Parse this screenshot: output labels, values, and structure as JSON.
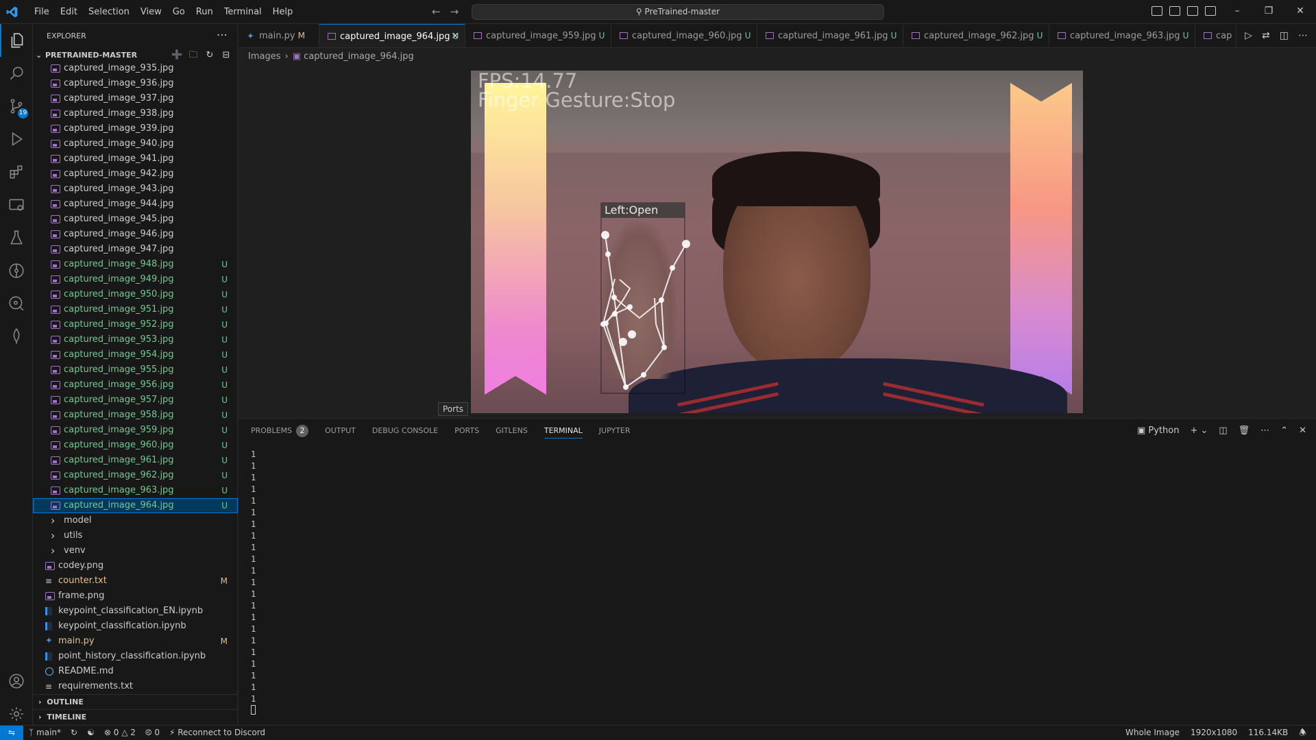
{
  "titlebar": {
    "menu": [
      "File",
      "Edit",
      "Selection",
      "View",
      "Go",
      "Run",
      "Terminal",
      "Help"
    ],
    "search_text": "PreTrained-master"
  },
  "activity": {
    "scm_badge": "19"
  },
  "sidebar": {
    "title": "EXPLORER",
    "project": "PRETRAINED-MASTER",
    "items": [
      {
        "name": "captured_image_935.jpg",
        "kind": "img",
        "status": "",
        "color": "#cccccc",
        "indent": 1
      },
      {
        "name": "captured_image_936.jpg",
        "kind": "img",
        "status": "",
        "color": "#cccccc",
        "indent": 1
      },
      {
        "name": "captured_image_937.jpg",
        "kind": "img",
        "status": "",
        "color": "#cccccc",
        "indent": 1
      },
      {
        "name": "captured_image_938.jpg",
        "kind": "img",
        "status": "",
        "color": "#cccccc",
        "indent": 1
      },
      {
        "name": "captured_image_939.jpg",
        "kind": "img",
        "status": "",
        "color": "#cccccc",
        "indent": 1
      },
      {
        "name": "captured_image_940.jpg",
        "kind": "img",
        "status": "",
        "color": "#cccccc",
        "indent": 1
      },
      {
        "name": "captured_image_941.jpg",
        "kind": "img",
        "status": "",
        "color": "#cccccc",
        "indent": 1
      },
      {
        "name": "captured_image_942.jpg",
        "kind": "img",
        "status": "",
        "color": "#cccccc",
        "indent": 1
      },
      {
        "name": "captured_image_943.jpg",
        "kind": "img",
        "status": "",
        "color": "#cccccc",
        "indent": 1
      },
      {
        "name": "captured_image_944.jpg",
        "kind": "img",
        "status": "",
        "color": "#cccccc",
        "indent": 1
      },
      {
        "name": "captured_image_945.jpg",
        "kind": "img",
        "status": "",
        "color": "#cccccc",
        "indent": 1
      },
      {
        "name": "captured_image_946.jpg",
        "kind": "img",
        "status": "",
        "color": "#cccccc",
        "indent": 1
      },
      {
        "name": "captured_image_947.jpg",
        "kind": "img",
        "status": "",
        "color": "#cccccc",
        "indent": 1
      },
      {
        "name": "captured_image_948.jpg",
        "kind": "img",
        "status": "U",
        "color": "#73c991",
        "indent": 1
      },
      {
        "name": "captured_image_949.jpg",
        "kind": "img",
        "status": "U",
        "color": "#73c991",
        "indent": 1
      },
      {
        "name": "captured_image_950.jpg",
        "kind": "img",
        "status": "U",
        "color": "#73c991",
        "indent": 1
      },
      {
        "name": "captured_image_951.jpg",
        "kind": "img",
        "status": "U",
        "color": "#73c991",
        "indent": 1
      },
      {
        "name": "captured_image_952.jpg",
        "kind": "img",
        "status": "U",
        "color": "#73c991",
        "indent": 1
      },
      {
        "name": "captured_image_953.jpg",
        "kind": "img",
        "status": "U",
        "color": "#73c991",
        "indent": 1
      },
      {
        "name": "captured_image_954.jpg",
        "kind": "img",
        "status": "U",
        "color": "#73c991",
        "indent": 1
      },
      {
        "name": "captured_image_955.jpg",
        "kind": "img",
        "status": "U",
        "color": "#73c991",
        "indent": 1
      },
      {
        "name": "captured_image_956.jpg",
        "kind": "img",
        "status": "U",
        "color": "#73c991",
        "indent": 1
      },
      {
        "name": "captured_image_957.jpg",
        "kind": "img",
        "status": "U",
        "color": "#73c991",
        "indent": 1
      },
      {
        "name": "captured_image_958.jpg",
        "kind": "img",
        "status": "U",
        "color": "#73c991",
        "indent": 1
      },
      {
        "name": "captured_image_959.jpg",
        "kind": "img",
        "status": "U",
        "color": "#73c991",
        "indent": 1
      },
      {
        "name": "captured_image_960.jpg",
        "kind": "img",
        "status": "U",
        "color": "#73c991",
        "indent": 1
      },
      {
        "name": "captured_image_961.jpg",
        "kind": "img",
        "status": "U",
        "color": "#73c991",
        "indent": 1
      },
      {
        "name": "captured_image_962.jpg",
        "kind": "img",
        "status": "U",
        "color": "#73c991",
        "indent": 1
      },
      {
        "name": "captured_image_963.jpg",
        "kind": "img",
        "status": "U",
        "color": "#73c991",
        "indent": 1
      },
      {
        "name": "captured_image_964.jpg",
        "kind": "img",
        "status": "U",
        "color": "#73c991",
        "indent": 1,
        "selected": true
      },
      {
        "name": "model",
        "kind": "folder",
        "status": "",
        "color": "#cccccc",
        "indent": 1
      },
      {
        "name": "utils",
        "kind": "folder",
        "status": "",
        "color": "#cccccc",
        "indent": 1
      },
      {
        "name": "venv",
        "kind": "folder",
        "status": "",
        "color": "#cccccc",
        "indent": 1
      },
      {
        "name": "codey.png",
        "kind": "img",
        "status": "",
        "color": "#cccccc",
        "indent": 0
      },
      {
        "name": "counter.txt",
        "kind": "txt",
        "status": "M",
        "color": "#e2c08d",
        "indent": 0
      },
      {
        "name": "frame.png",
        "kind": "img",
        "status": "",
        "color": "#cccccc",
        "indent": 0
      },
      {
        "name": "keypoint_classification_EN.ipynb",
        "kind": "nb",
        "status": "",
        "color": "#cccccc",
        "indent": 0
      },
      {
        "name": "keypoint_classification.ipynb",
        "kind": "nb",
        "status": "",
        "color": "#cccccc",
        "indent": 0
      },
      {
        "name": "main.py",
        "kind": "py",
        "status": "M",
        "color": "#e2c08d",
        "indent": 0
      },
      {
        "name": "point_history_classification.ipynb",
        "kind": "nb",
        "status": "",
        "color": "#cccccc",
        "indent": 0
      },
      {
        "name": "README.md",
        "kind": "info",
        "status": "",
        "color": "#cccccc",
        "indent": 0
      },
      {
        "name": "requirements.txt",
        "kind": "txt",
        "status": "",
        "color": "#cccccc",
        "indent": 0
      }
    ],
    "outline_label": "OUTLINE",
    "timeline_label": "TIMELINE"
  },
  "tabs": [
    {
      "label": "main.py",
      "status": "M",
      "status_color": "#e2c08d",
      "kind": "py"
    },
    {
      "label": "captured_image_964.jpg",
      "status": "U",
      "status_color": "#73c991",
      "kind": "img",
      "active": true
    },
    {
      "label": "captured_image_959.jpg",
      "status": "U",
      "status_color": "#73c991",
      "kind": "img"
    },
    {
      "label": "captured_image_960.jpg",
      "status": "U",
      "status_color": "#73c991",
      "kind": "img"
    },
    {
      "label": "captured_image_961.jpg",
      "status": "U",
      "status_color": "#73c991",
      "kind": "img"
    },
    {
      "label": "captured_image_962.jpg",
      "status": "U",
      "status_color": "#73c991",
      "kind": "img"
    },
    {
      "label": "captured_image_963.jpg",
      "status": "U",
      "status_color": "#73c991",
      "kind": "img"
    },
    {
      "label": "cap",
      "status": "",
      "status_color": "#73c991",
      "kind": "img"
    }
  ],
  "breadcrumb": {
    "folder": "Images",
    "file": "captured_image_964.jpg"
  },
  "image": {
    "fps_text": "FPS:14.77",
    "gesture_text": "Finger Gesture:Stop",
    "hand_label": "Left:Open"
  },
  "tooltip": "Ports",
  "panel": {
    "tabs": [
      {
        "label": "PROBLEMS",
        "count": "2"
      },
      {
        "label": "OUTPUT"
      },
      {
        "label": "DEBUG CONSOLE"
      },
      {
        "label": "PORTS"
      },
      {
        "label": "GITLENS"
      },
      {
        "label": "TERMINAL",
        "active": true
      },
      {
        "label": "JUPYTER"
      }
    ],
    "terminal_profile": "Python",
    "terminal_lines": [
      "1",
      "1",
      "1",
      "1",
      "1",
      "1",
      "1",
      "1",
      "1",
      "1",
      "1",
      "1",
      "1",
      "1",
      "1",
      "1",
      "1",
      "1",
      "1",
      "1",
      "1",
      "1"
    ]
  },
  "statusbar": {
    "branch": "main*",
    "errors": "0",
    "warnings": "2",
    "ports": "0",
    "discord": "Reconnect to Discord",
    "zoom": "Whole Image",
    "dims": "1920x1080",
    "size": "116.14KB"
  }
}
